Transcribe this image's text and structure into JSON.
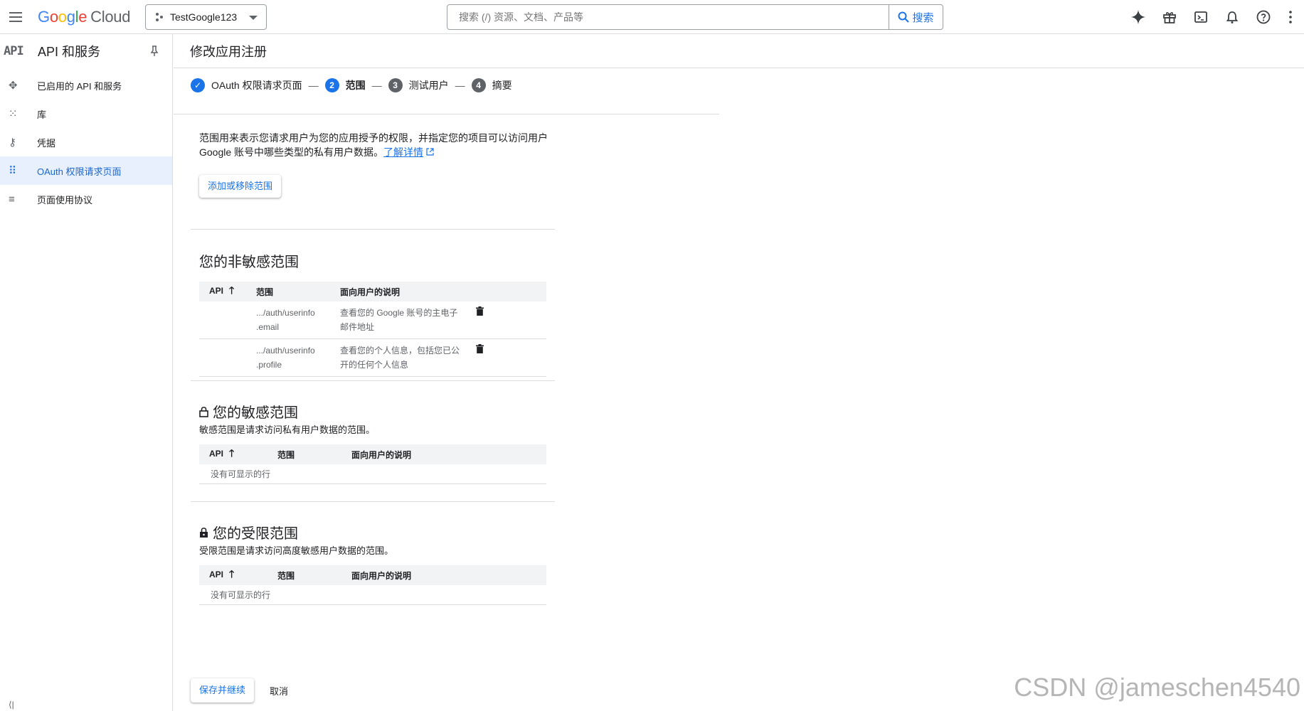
{
  "topbar": {
    "logo": {
      "g1": "G",
      "g2": "o",
      "g3": "o",
      "g4": "g",
      "g5": "l",
      "g6": "e",
      "cloud": "Cloud"
    },
    "project_name": "TestGoogle123",
    "search_placeholder": "搜索 (/) 资源、文档、产品等",
    "search_button": "搜索",
    "icons": [
      "gemini-icon",
      "gift-icon",
      "terminal-icon",
      "bell-icon",
      "help-icon",
      "more-vert-icon"
    ]
  },
  "sidebar": {
    "logo": "API",
    "title": "API 和服务",
    "items": [
      {
        "label": "已启用的 API 和服务",
        "icon": "✥"
      },
      {
        "label": "库",
        "icon": "⁙"
      },
      {
        "label": "凭据",
        "icon": "⚷"
      },
      {
        "label": "OAuth 权限请求页面",
        "icon": "⠿"
      },
      {
        "label": "页面使用协议",
        "icon": "≡"
      }
    ],
    "collapse_glyph": "⟨|"
  },
  "main": {
    "title": "修改应用注册",
    "steps": [
      {
        "num": "✓",
        "label": "OAuth 权限请求页面"
      },
      {
        "num": "2",
        "label": "范围"
      },
      {
        "num": "3",
        "label": "测试用户"
      },
      {
        "num": "4",
        "label": "摘要"
      }
    ],
    "dash": "—",
    "description": "范围用来表示您请求用户为您的应用授予的权限，并指定您的项目可以访问用户 Google 账号中哪些类型的私有用户数据。",
    "learn_more": "了解详情",
    "add_remove_button": "添加或移除范围",
    "nonsensitive": {
      "title": "您的非敏感范围",
      "headers": {
        "api": "API",
        "scope": "范围",
        "desc": "面向用户的说明"
      },
      "rows": [
        {
          "scope1": ".../auth/userinfo",
          "scope2": ".email",
          "desc1": "查看您的 Google 账号的主电子",
          "desc2": "邮件地址"
        },
        {
          "scope1": ".../auth/userinfo",
          "scope2": ".profile",
          "desc1": "查看您的个人信息，包括您已公",
          "desc2": "开的任何个人信息"
        }
      ]
    },
    "sensitive": {
      "title": "您的敏感范围",
      "description": "敏感范围是请求访问私有用户数据的范围。",
      "headers": {
        "api": "API",
        "scope": "范围",
        "desc": "面向用户的说明"
      },
      "empty": "没有可显示的行"
    },
    "restricted": {
      "title": "您的受限范围",
      "description": "受限范围是请求访问高度敏感用户数据的范围。",
      "headers": {
        "api": "API",
        "scope": "范围",
        "desc": "面向用户的说明"
      },
      "empty": "没有可显示的行"
    },
    "save_button": "保存并继续",
    "cancel_button": "取消"
  },
  "watermark": "CSDN @jameschen4540",
  "colors": {
    "accent": "#1a73e8",
    "active_bg": "#e8f0fe",
    "border": "#dadce0"
  }
}
